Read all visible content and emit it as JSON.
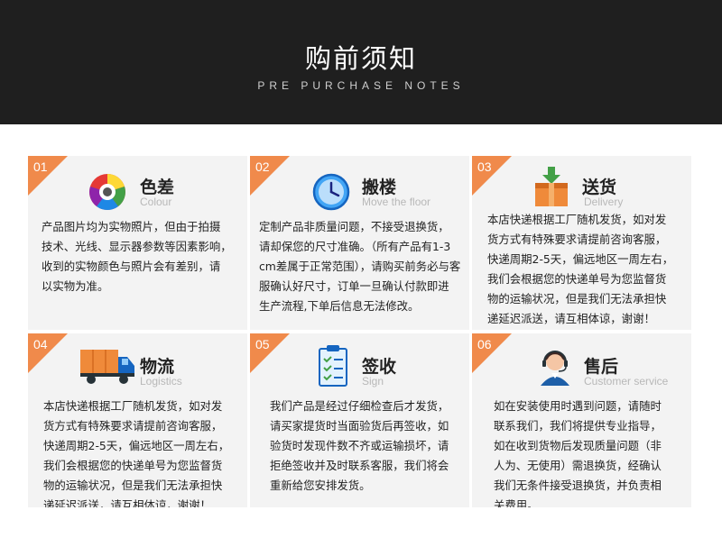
{
  "header": {
    "title": "购前须知",
    "subtitle": "PRE PURCHASE NOTES"
  },
  "cards": [
    {
      "num": "01",
      "title": "色差",
      "subtitle": "Colour",
      "icon": "color-wheel-icon",
      "lines": [
        "产品图片均为实物照片，但由于拍摄",
        "技术、光线、显示器参数等因素影响，",
        "收到的实物颜色与照片会有差别，请",
        "以实物为准。"
      ]
    },
    {
      "num": "02",
      "title": "搬楼",
      "subtitle": "Move the floor",
      "icon": "clock-icon",
      "lines": [
        "定制产品非质量问题，不接受退换货，",
        "请却保您的尺寸准确。（所有产品有1-3",
        "cm差属于正常范围），请购买前务必与客",
        "服确认好尺寸，订单一旦确认付款即进",
        "生产流程,下单后信息无法修改。"
      ]
    },
    {
      "num": "03",
      "title": "送货",
      "subtitle": "Delivery",
      "icon": "package-icon",
      "lines": [
        "本店快递根据工厂随机发货，如对发",
        "货方式有特殊要求请提前咨询客服，",
        "快递周期2-5天，偏远地区一周左右，",
        "我们会根据您的快递单号为您监督货",
        "物的运输状况，但是我们无法承担快",
        "递延迟派送，请互相体谅，谢谢！"
      ]
    },
    {
      "num": "04",
      "title": "物流",
      "subtitle": "Logistics",
      "icon": "truck-icon",
      "lines": [
        "本店快递根据工厂随机发货，如对发",
        "货方式有特殊要求请提前咨询客服，",
        "快递周期2-5天，偏远地区一周左右，",
        "我们会根据您的快递单号为您监督货",
        "物的运输状况，但是我们无法承担快",
        "递延迟派送，请互相体谅，谢谢！"
      ]
    },
    {
      "num": "05",
      "title": "签收",
      "subtitle": "Sign",
      "icon": "checklist-icon",
      "lines": [
        "我们产品是经过仔细检查后才发货，",
        "请买家提货时当面验货后再签收，如",
        "验货时发现件数不齐或运输损坏，请",
        "拒绝签收并及时联系客服，我们将会",
        "重新给您安排发货。"
      ]
    },
    {
      "num": "06",
      "title": "售后",
      "subtitle": "Customer service",
      "icon": "headset-agent-icon",
      "lines": [
        "如在安装使用时遇到问题，请随时",
        "联系我们，我们将提供专业指导，",
        "如在收到货物后发现质量问题（非",
        "人为、无使用）需退换货，经确认",
        "我们无条件接受退换货，并负责相",
        "关费用。"
      ]
    }
  ]
}
